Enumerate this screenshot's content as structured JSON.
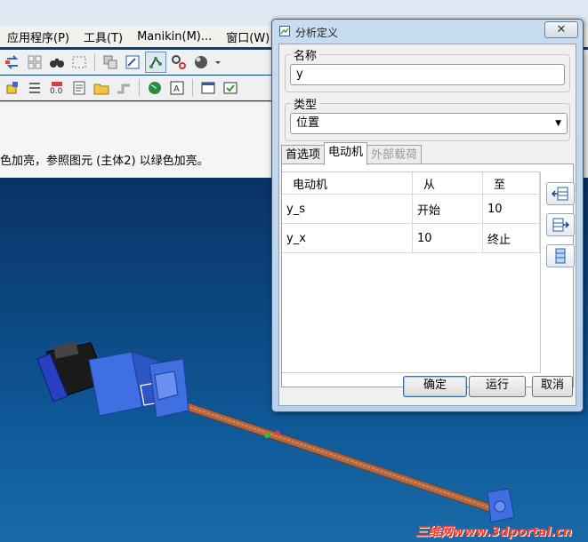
{
  "menubar": {
    "items": [
      "应用程序(P)",
      "工具(T)",
      "Manikin(M)...",
      "窗口(W)"
    ]
  },
  "message": {
    "text": "色加亮，参照图元 (主体2) 以绿色加亮。"
  },
  "dialog": {
    "title": "分析定义",
    "name_label": "名称",
    "name_value": "y",
    "type_label": "类型",
    "type_value": "位置",
    "tabs": [
      "首选项",
      "电动机",
      "外部载荷"
    ],
    "table": {
      "headers": [
        "电动机",
        "从",
        "至"
      ],
      "rows": [
        [
          "y_s",
          "开始",
          "10"
        ],
        [
          "y_x",
          "10",
          "终止"
        ]
      ]
    },
    "buttons": {
      "ok": "确定",
      "run": "运行",
      "cancel": "取消"
    }
  },
  "watermark": "三维网www.3dportal.cn",
  "colors": {
    "viewport_top": "#0a3265",
    "viewport_bottom": "#1a6aa8",
    "dialog_frame": "#c8dcf0",
    "shaft": "#b5683f",
    "watermark": "#ff3a2e"
  },
  "icons": {
    "dialog_title": "analysis-icon",
    "close": "close-icon",
    "side_buttons": [
      "insert-row-icon",
      "append-row-icon",
      "grid-icon"
    ]
  }
}
